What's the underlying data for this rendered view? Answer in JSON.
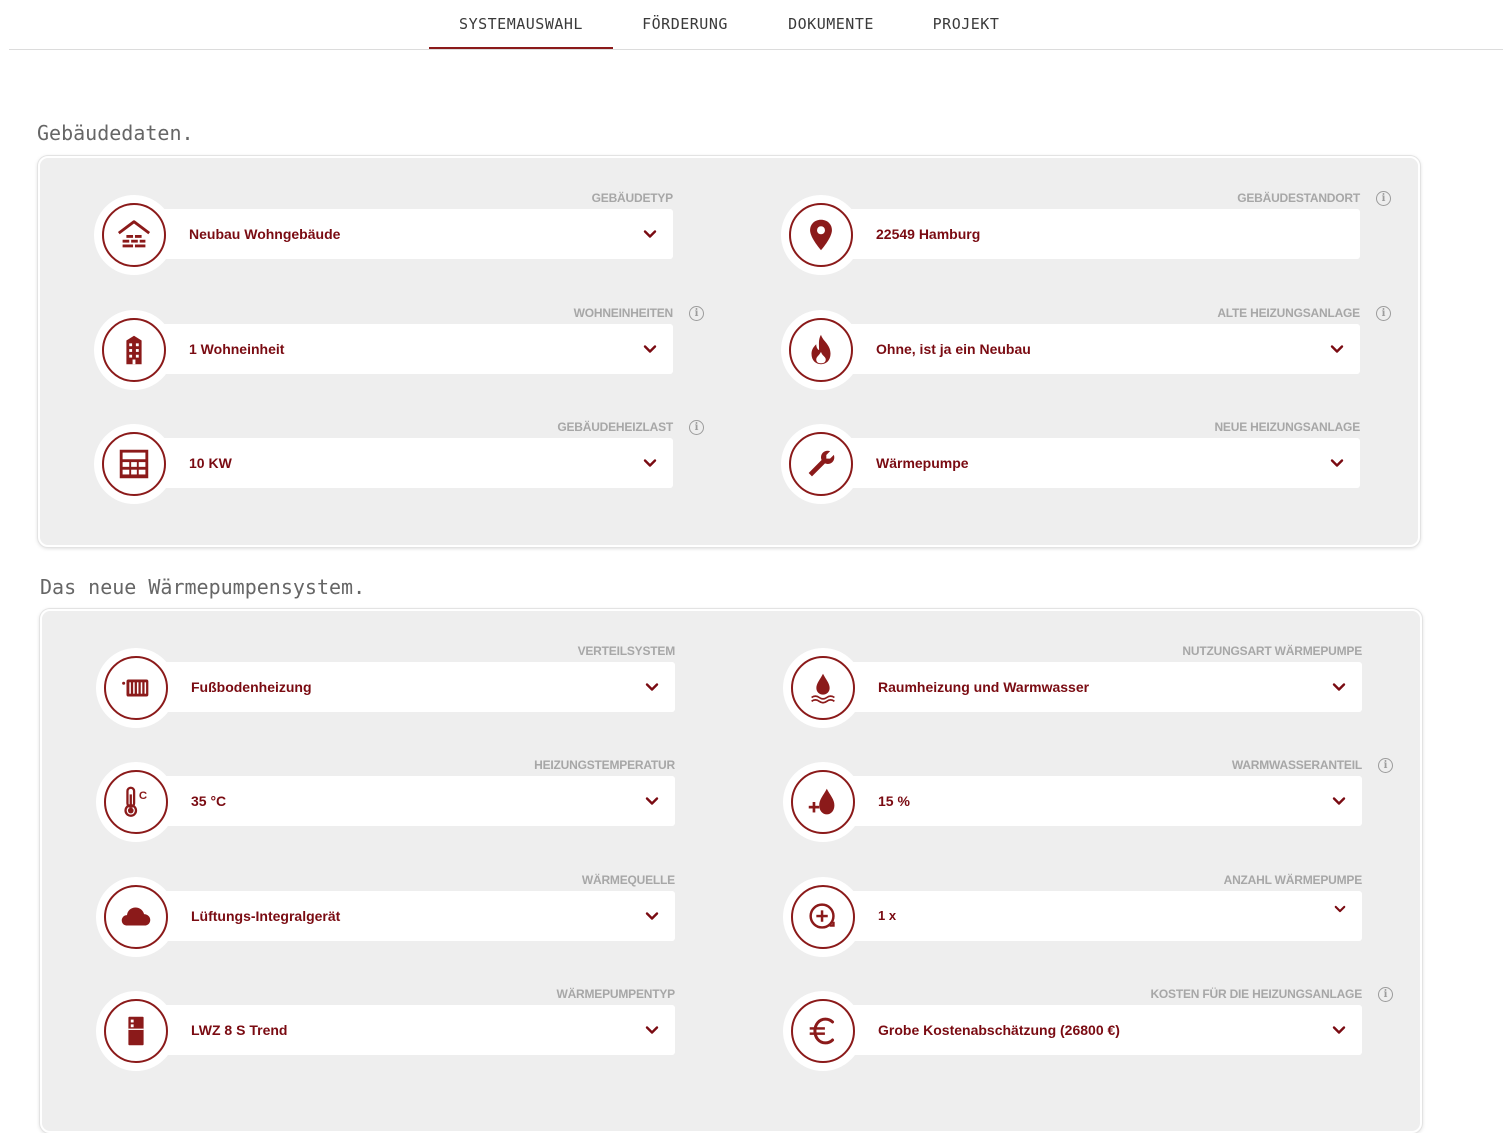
{
  "nav": {
    "tabs": [
      {
        "label": "SYSTEMAUSWAHL",
        "active": true
      },
      {
        "label": "FÖRDERUNG",
        "active": false
      },
      {
        "label": "DOKUMENTE",
        "active": false
      },
      {
        "label": "PROJEKT",
        "active": false
      }
    ]
  },
  "colors": {
    "accent": "#8b1a1a",
    "value_text": "#7a0b12",
    "label_text": "#a7a7a7",
    "panel_bg": "#eeeeee"
  },
  "building": {
    "title": "Gebäudedaten.",
    "fields": [
      {
        "label": "GEBÄUDETYP",
        "value": "Neubau Wohngebäude",
        "icon": "house-bricks-icon",
        "info": false,
        "dropdown": true
      },
      {
        "label": "GEBÄUDESTANDORT",
        "value": "22549 Hamburg",
        "icon": "location-pin-icon",
        "info": true,
        "dropdown": false
      },
      {
        "label": "WOHNEINHEITEN",
        "value": "1 Wohneinheit",
        "icon": "building-icon",
        "info": true,
        "dropdown": true
      },
      {
        "label": "ALTE HEIZUNGSANLAGE",
        "value": "Ohne, ist ja ein Neubau",
        "icon": "flame-icon",
        "info": true,
        "dropdown": true
      },
      {
        "label": "GEBÄUDEHEIZLAST",
        "value": "10 KW",
        "icon": "calculator-icon",
        "info": true,
        "dropdown": true
      },
      {
        "label": "NEUE HEIZUNGSANLAGE",
        "value": "Wärmepumpe",
        "icon": "wrench-icon",
        "info": false,
        "dropdown": true
      }
    ]
  },
  "heatpump": {
    "title": "Das neue Wärmepumpensystem.",
    "fields": [
      {
        "label": "VERTEILSYSTEM",
        "value": "Fußbodenheizung",
        "icon": "radiator-icon",
        "info": false,
        "dropdown": true
      },
      {
        "label": "NUTZUNGSART WÄRMEPUMPE",
        "value": "Raumheizung und Warmwasser",
        "icon": "water-drop-waves-icon",
        "info": false,
        "dropdown": true
      },
      {
        "label": "HEIZUNGSTEMPERATUR",
        "value": "35 °C",
        "icon": "thermometer-icon",
        "info": false,
        "dropdown": true
      },
      {
        "label": "WARMWASSERANTEIL",
        "value": "15 %",
        "icon": "drop-plus-icon",
        "info": true,
        "dropdown": true
      },
      {
        "label": "WÄRMEQUELLE",
        "value": "Lüftungs-Integralgerät",
        "icon": "cloud-icon",
        "info": false,
        "dropdown": true
      },
      {
        "label": "ANZAHL WÄRMEPUMPE",
        "value": "1 x",
        "icon": "plus-circle-icon",
        "info": false,
        "dropdown": true
      },
      {
        "label": "WÄRMEPUMPENTYP",
        "value": "LWZ 8 S Trend",
        "icon": "heatpump-unit-icon",
        "info": false,
        "dropdown": true
      },
      {
        "label": "KOSTEN FÜR DIE HEIZUNGSANLAGE",
        "value": "Grobe Kostenabschätzung (26800 €)",
        "icon": "euro-icon",
        "info": true,
        "dropdown": true
      }
    ]
  }
}
